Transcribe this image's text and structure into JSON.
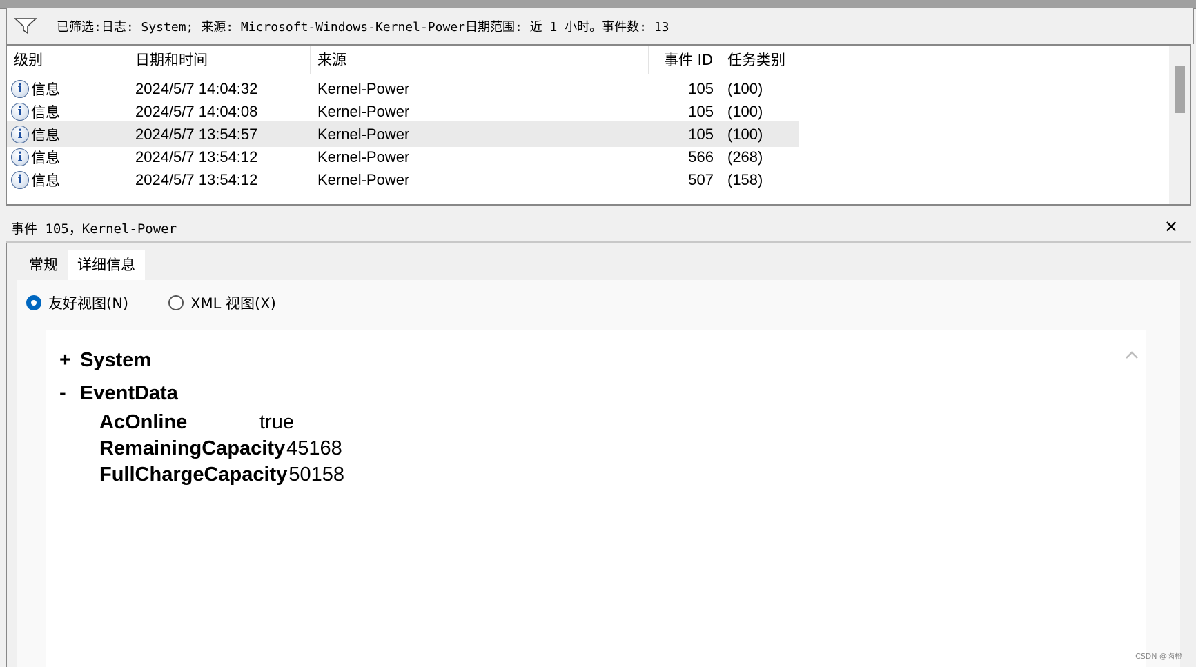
{
  "filter": {
    "text": "已筛选:日志: System; 来源: Microsoft-Windows-Kernel-Power日期范围: 近 1 小时。事件数: 13"
  },
  "list": {
    "columns": [
      "级别",
      "日期和时间",
      "来源",
      "事件 ID",
      "任务类别"
    ],
    "rows": [
      {
        "level": "信息",
        "datetime": "2024/5/7 14:04:32",
        "source": "Kernel-Power",
        "event_id": "105",
        "task": "(100)"
      },
      {
        "level": "信息",
        "datetime": "2024/5/7 14:04:08",
        "source": "Kernel-Power",
        "event_id": "105",
        "task": "(100)"
      },
      {
        "level": "信息",
        "datetime": "2024/5/7 13:54:57",
        "source": "Kernel-Power",
        "event_id": "105",
        "task": "(100)"
      },
      {
        "level": "信息",
        "datetime": "2024/5/7 13:54:12",
        "source": "Kernel-Power",
        "event_id": "566",
        "task": "(268)"
      },
      {
        "level": "信息",
        "datetime": "2024/5/7 13:54:12",
        "source": "Kernel-Power",
        "event_id": "507",
        "task": "(158)"
      }
    ]
  },
  "detail": {
    "title": "事件 105，Kernel-Power",
    "close": "✕",
    "tabs": [
      "常规",
      "详细信息"
    ],
    "radios": [
      "友好视图(N)",
      "XML 视图(X)"
    ],
    "tree": {
      "system_toggle": "+",
      "system": "System",
      "eventdata_toggle": "-",
      "eventdata": "EventData",
      "fields": [
        {
          "key": "AcOnline",
          "value": "true"
        },
        {
          "key": "RemainingCapacity",
          "value": "45168"
        },
        {
          "key": "FullChargeCapacity",
          "value": "50158"
        }
      ]
    }
  },
  "watermark": "CSDN @卤橙"
}
